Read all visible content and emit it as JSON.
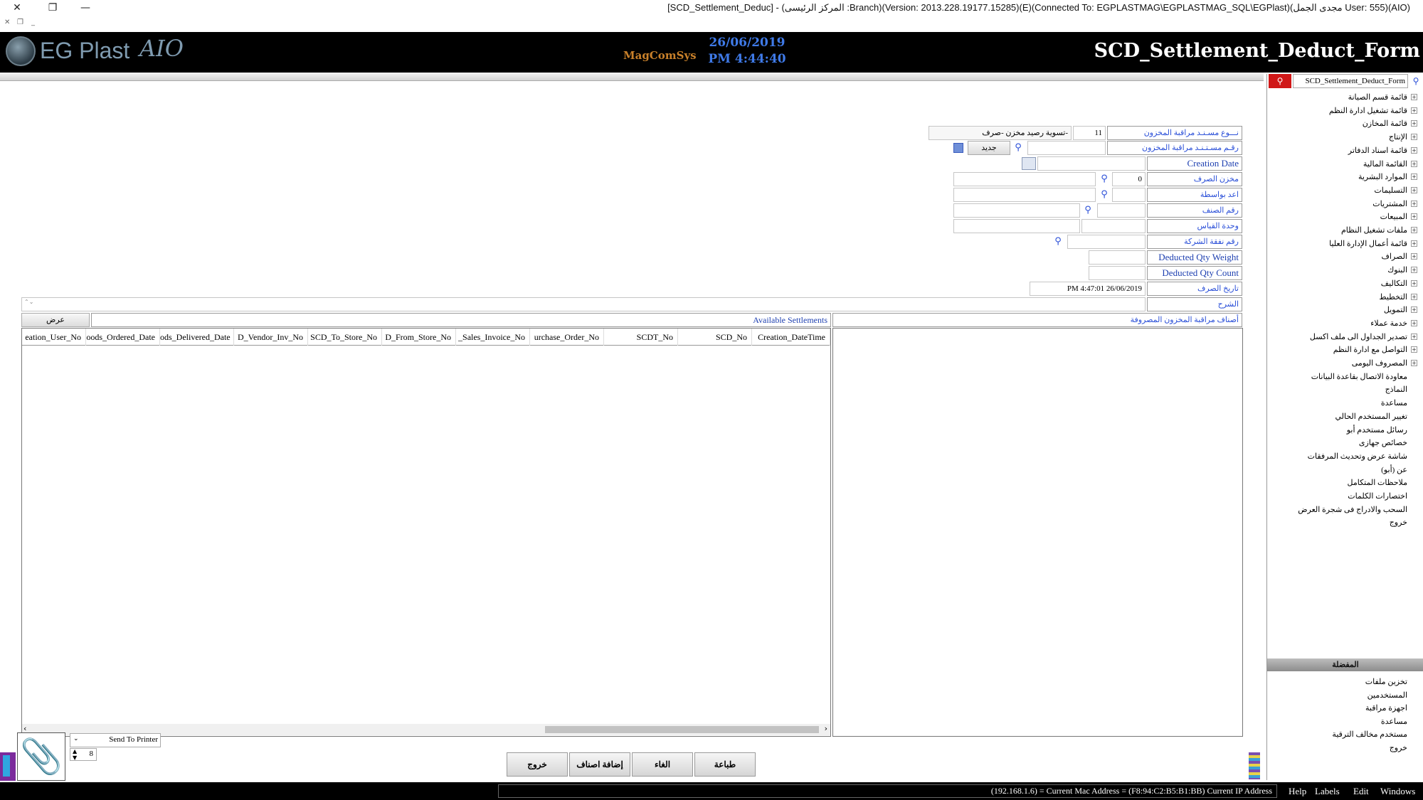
{
  "window": {
    "title": "[SCD_Settlement_Deduc] - (المركز الرئيسى :Branch)(Version: 2013.228.19177.15285)(E)(Connected To: EGPLASTMAG\\EGPLASTMAG_SQL\\EGPlast)(مجدى الجمل User: 555)(AIO)"
  },
  "header": {
    "logo_text": "EG Plast",
    "logo_suffix": "AIO",
    "brand": "MagComSys",
    "date": "26/06/2019",
    "time": "PM 4:44:40",
    "form_name": "SCD_Settlement_Deduct_Form"
  },
  "form": {
    "doc_type_label": "نـــوع مسـنـد مراقبة المخزون",
    "doc_type_code": "11",
    "doc_type_name": "تسوية رصيد مخزن -صرف-",
    "doc_no_label": "رقـم مسـتـنـد مراقبة المخزون",
    "new_button": "جديد",
    "creation_date_label": "Creation Date",
    "store_label": "مخزن الصرف",
    "store_value": "0",
    "prepared_by_label": "اعد بواسطة",
    "item_no_label": "رقم الصنف",
    "unit_label": "وحدة القياس",
    "company_no_label": "رقم نفقة الشركة",
    "deducted_weight_label": "Deducted Qty Weight",
    "deducted_count_label": "Deducted Qty Count",
    "deduct_date_label": "تاريخ الصرف",
    "deduct_date_value": "PM 4:47:01 26/06/2019",
    "notes_label": "الشرح"
  },
  "grid": {
    "show_button": "عرض",
    "available_label": "Available Settlements",
    "items_label": "أصناف مراقبة المخزون المصروفة",
    "columns": [
      "eation_User_No",
      "oods_Ordered_Date",
      "ods_Delivered_Date",
      "D_Vendor_Inv_No",
      "SCD_To_Store_No",
      "D_From_Store_No",
      "_Sales_Invoice_No",
      "urchase_Order_No",
      "SCDT_No",
      "SCD_No",
      "Creation_DateTime"
    ]
  },
  "print": {
    "send_to_printer": "Send To Printer",
    "copies": "8"
  },
  "actions": {
    "exit": "خروج",
    "add_items": "إضافة اصناف",
    "cancel": "الغاء",
    "print": "طباعة"
  },
  "side": {
    "search_value": "SCD_Settlement_Deduct_Form",
    "tree": [
      {
        "label": "قائمة قسم الصيانة",
        "expand": true
      },
      {
        "label": "قائمة تشغيل ادارة النظم",
        "expand": true
      },
      {
        "label": "قائمة المخازن",
        "expand": true
      },
      {
        "label": "الإنتاج",
        "expand": true
      },
      {
        "label": "قائمة اسناد الدفاتر",
        "expand": true
      },
      {
        "label": "القائمة المالية",
        "expand": true
      },
      {
        "label": "الموارد البشرية",
        "expand": true
      },
      {
        "label": "التسليمات",
        "expand": true
      },
      {
        "label": "المشتريات",
        "expand": true
      },
      {
        "label": "المبيعات",
        "expand": true
      },
      {
        "label": "ملفات تشغيل النظام",
        "expand": true
      },
      {
        "label": "قائمة أعمال الإدارة العليا",
        "expand": true
      },
      {
        "label": "الصراف",
        "expand": true
      },
      {
        "label": "البنوك",
        "expand": true
      },
      {
        "label": "التكاليف",
        "expand": true
      },
      {
        "label": "التخطيط",
        "expand": true
      },
      {
        "label": "التمويل",
        "expand": true
      },
      {
        "label": "خدمة عملاء",
        "expand": true
      },
      {
        "label": "تصدير الجداول الى ملف اكسل",
        "expand": true
      },
      {
        "label": "التواصل مع ادارة النظم",
        "expand": true
      },
      {
        "label": "المصروف اليومى",
        "expand": true
      },
      {
        "label": "معاودة الاتصال بقاعدة البيانات",
        "expand": false
      },
      {
        "label": "النماذج",
        "expand": false
      },
      {
        "label": "مساعدة",
        "expand": false
      },
      {
        "label": "تغيير المستخدم الحالي",
        "expand": false
      },
      {
        "label": "رسائل مستخدم أبو",
        "expand": false
      },
      {
        "label": "خصائص جهازى",
        "expand": false
      },
      {
        "label": "شاشة عرض وتحديث المرفقات",
        "expand": false
      },
      {
        "label": "عن (أبو)",
        "expand": false
      },
      {
        "label": "ملاحظات المتكامل",
        "expand": false
      },
      {
        "label": "اختصارات الكلمات",
        "expand": false
      },
      {
        "label": "السحب والادراج فى شجرة العرض",
        "expand": false
      },
      {
        "label": "خروج",
        "expand": false
      }
    ],
    "favorites_title": "المفضلة",
    "favorites": [
      "تخزين ملفات",
      "المستخدمين",
      "اجهزة مراقبة",
      "مساعدة",
      "مستخدم مخالف الترقية",
      "خروج"
    ]
  },
  "status": {
    "info": "(192.168.1.6) = Current Mac Address = (F8:94:C2:B5:B1:BB) Current IP Address",
    "menus": [
      "Help",
      "Labels",
      "Edit",
      "Windows"
    ]
  },
  "colors": {
    "label_text": "#2a4fd8",
    "header_bg": "#000000",
    "clock": "#3f7ae8"
  }
}
